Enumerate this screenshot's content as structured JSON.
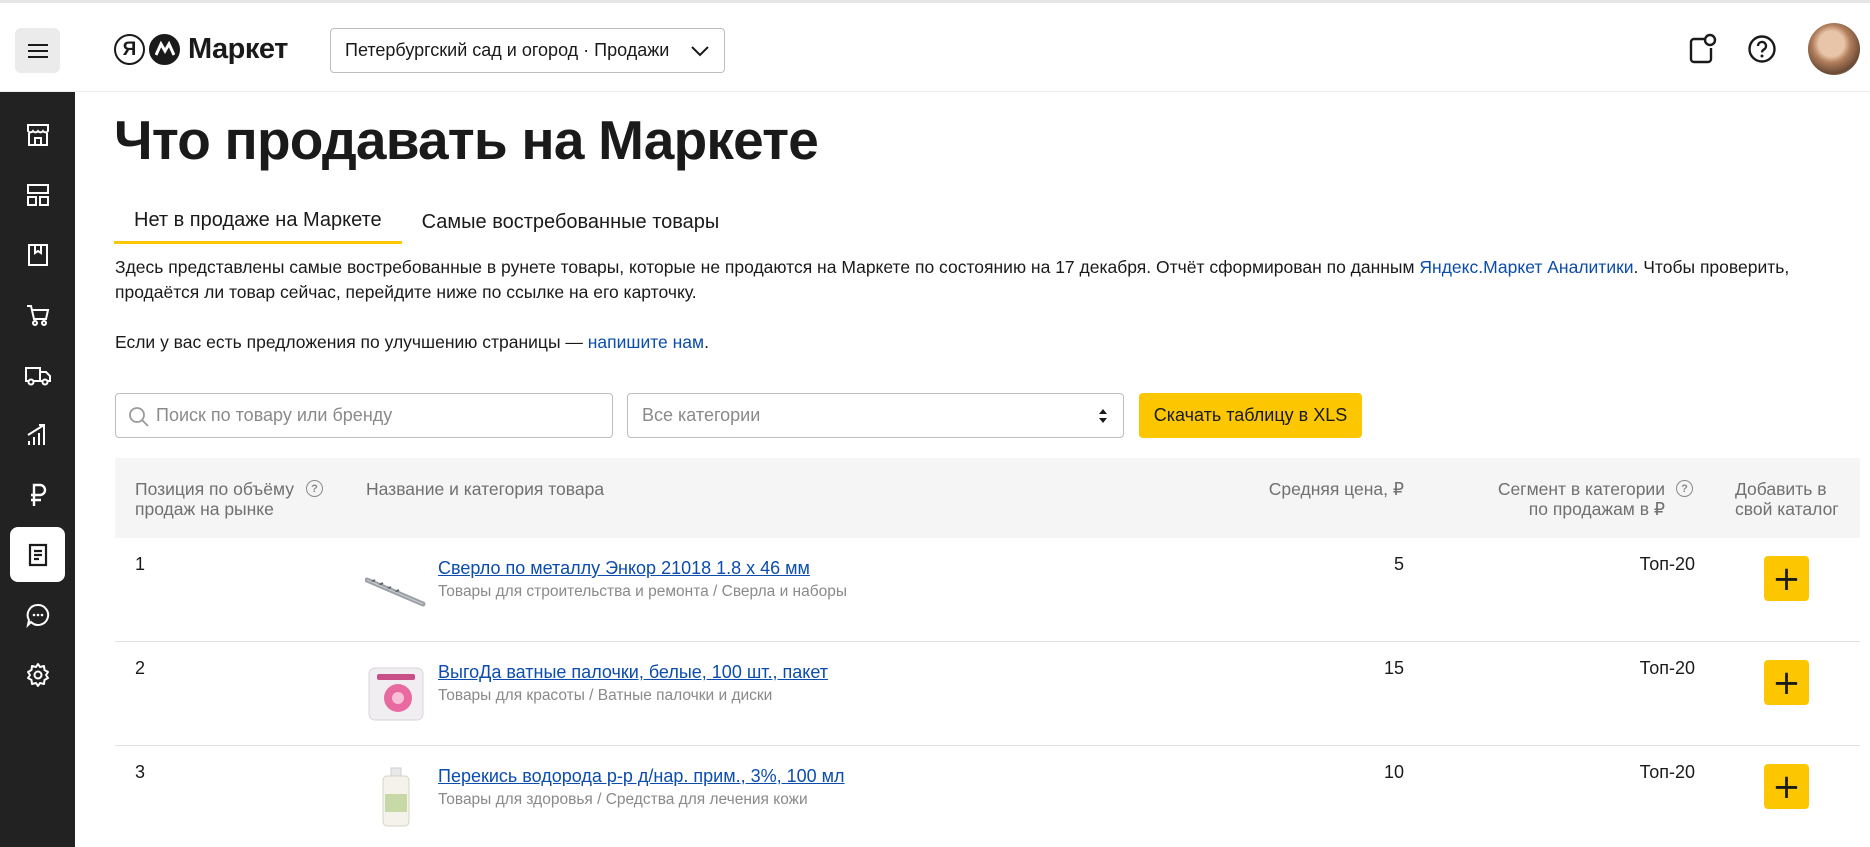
{
  "header": {
    "logo_letter": "Я",
    "logo_text": "Маркет",
    "store_select": "Петербургский сад и огород · Продажи"
  },
  "page": {
    "title": "Что продавать на Маркете",
    "tabs": [
      {
        "label": "Нет в продаже на Маркете",
        "active": true
      },
      {
        "label": "Самые востребованные товары",
        "active": false
      }
    ],
    "description_prefix": "Здесь представлены самые востребованные в рунете товары, которые не продаются на Маркете по состоянию на 17 декабря. Отчёт сформирован по данным ",
    "description_link": "Яндекс.Маркет Аналитики",
    "description_suffix": ". Чтобы проверить, продаётся ли товар сейчас, перейдите ниже по ссылке на его карточку.",
    "feedback_prefix": "Если у вас есть предложения по улучшению страницы — ",
    "feedback_link": "напишите нам",
    "feedback_suffix": "."
  },
  "filters": {
    "search_placeholder": "Поиск по товару или бренду",
    "category_value": "Все категории",
    "download_label": "Скачать таблицу в XLS"
  },
  "table": {
    "columns": {
      "position": "Позиция по объёму продаж на рынке",
      "name": "Название и категория товара",
      "price": "Средняя цена, ₽",
      "segment": "Сегмент в категории по продажам в ₽",
      "add": "Добавить в свой каталог"
    },
    "rows": [
      {
        "position": "1",
        "name": "Сверло по металлу Энкор 21018 1.8 x 46 мм",
        "category": "Товары для строительства и ремонта / Сверла и наборы",
        "price": "5",
        "segment": "Топ-20",
        "add": "+"
      },
      {
        "position": "2",
        "name": "ВыгоДа ватные палочки, белые, 100 шт., пакет",
        "category": "Товары для красоты / Ватные палочки и диски",
        "price": "15",
        "segment": "Топ-20",
        "add": "+"
      },
      {
        "position": "3",
        "name": "Перекись водорода р-р д/нар. прим., 3%, 100 мл",
        "category": "Товары для здоровья / Средства для лечения кожи",
        "price": "10",
        "segment": "Топ-20",
        "add": "+"
      }
    ]
  },
  "colors": {
    "accent": "#fcc700",
    "link": "#0b4cad",
    "sidebar": "#222222"
  }
}
